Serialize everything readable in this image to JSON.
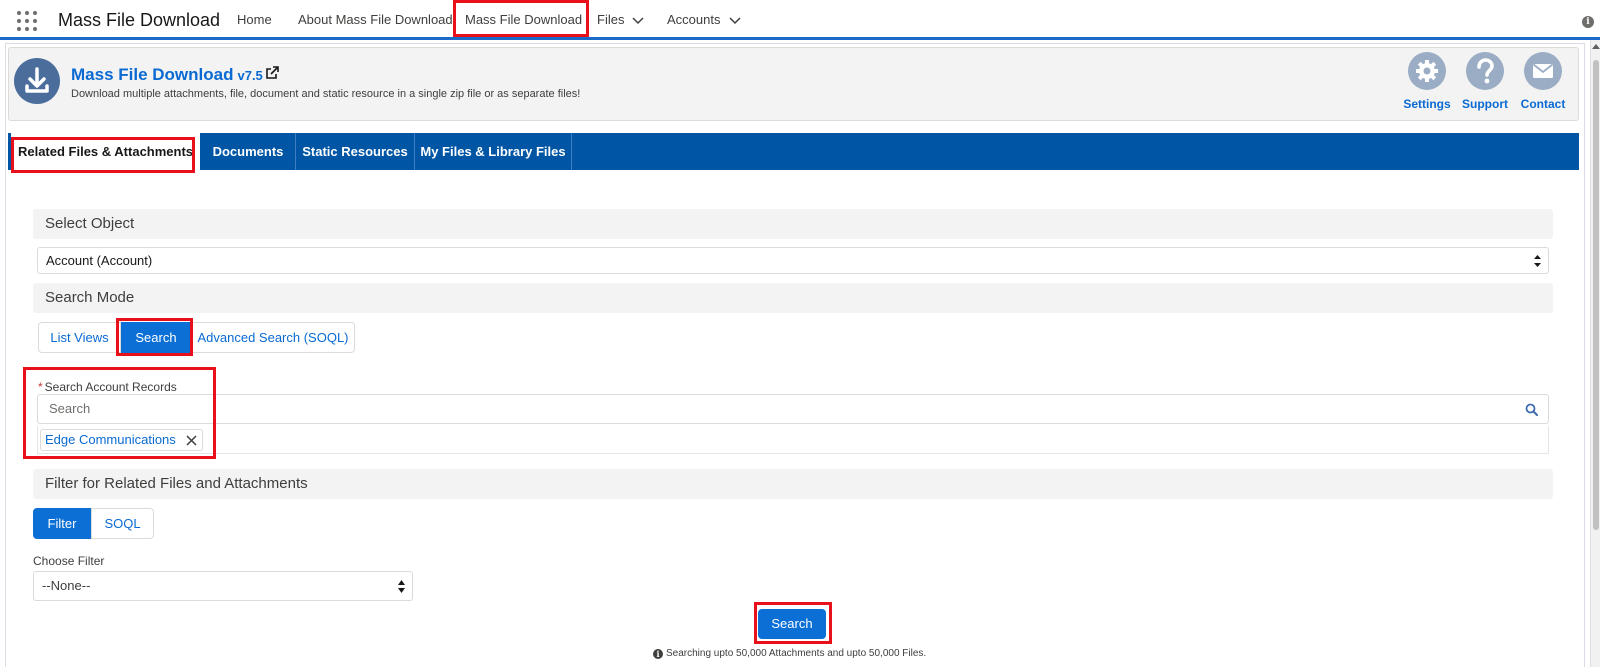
{
  "app": {
    "name": "Mass File Download"
  },
  "nav": {
    "items": [
      {
        "label": "Home"
      },
      {
        "label": "About Mass File Download"
      },
      {
        "label": "Mass File Download"
      },
      {
        "label": "Files"
      },
      {
        "label": "Accounts"
      }
    ]
  },
  "header": {
    "title": "Mass File Download",
    "version": "v7.5",
    "description": "Download multiple attachments, file, document and static resource in a single zip file or as separate files!",
    "actions": [
      {
        "label": "Settings",
        "icon": "gear-icon"
      },
      {
        "label": "Support",
        "icon": "question-icon"
      },
      {
        "label": "Contact",
        "icon": "mail-icon"
      }
    ]
  },
  "tabs": [
    {
      "label": "Related Files & Attachments",
      "active": true
    },
    {
      "label": "Documents"
    },
    {
      "label": "Static Resources"
    },
    {
      "label": "My Files & Library Files"
    }
  ],
  "select_object": {
    "heading": "Select Object",
    "value": "Account (Account)"
  },
  "search_mode": {
    "heading": "Search Mode",
    "options": [
      "List Views",
      "Search",
      "Advanced Search (SOQL)"
    ],
    "selected": "Search"
  },
  "record_search": {
    "required_mark": "*",
    "label": "Search Account Records",
    "placeholder": "Search",
    "selected_pill": "Edge Communications"
  },
  "filter": {
    "heading": "Filter for Related Files and Attachments",
    "modes": [
      "Filter",
      "SOQL"
    ],
    "selected_mode": "Filter",
    "choose_label": "Choose Filter",
    "choose_value": "--None--"
  },
  "actions": {
    "search_button": "Search",
    "note": "Searching upto 50,000 Attachments and upto 50,000 Files."
  },
  "colors": {
    "brand_blue": "#0b6fd6",
    "tab_bar": "#0055a5",
    "highlight_red": "#e8101a"
  }
}
